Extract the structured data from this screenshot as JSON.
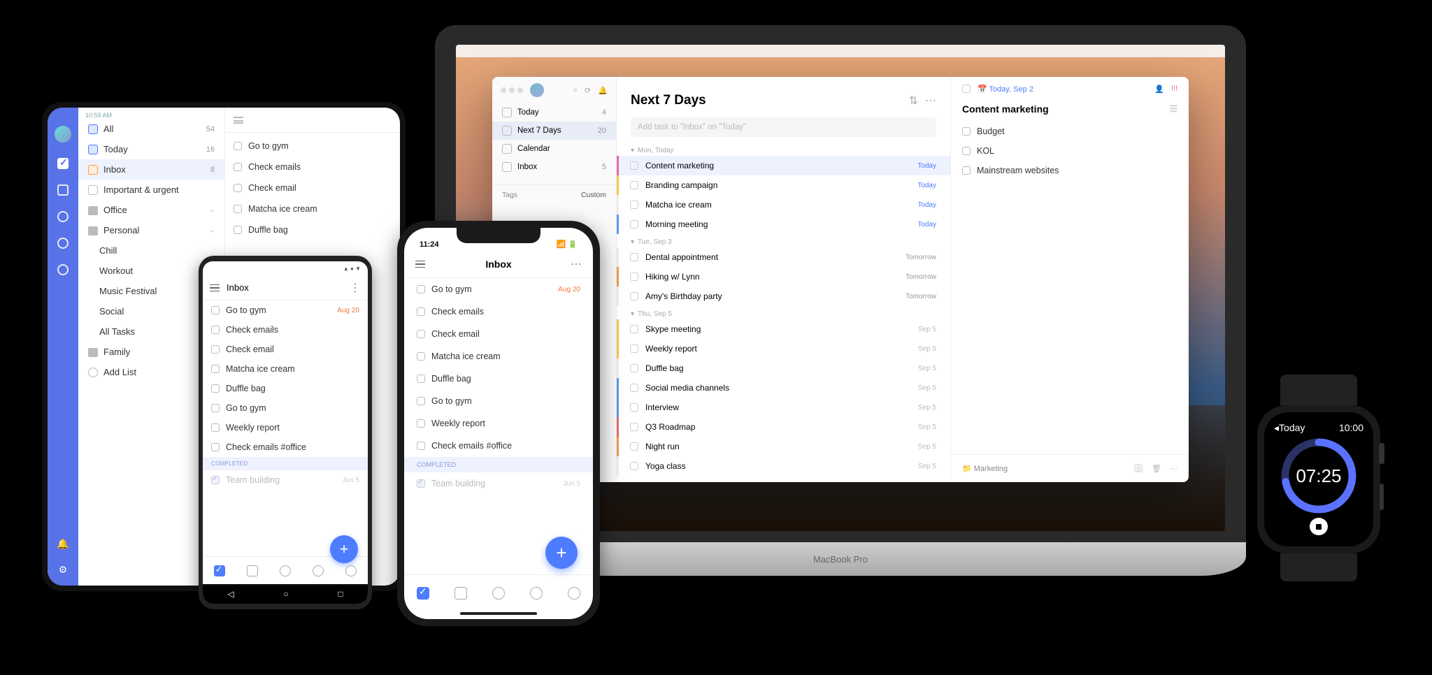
{
  "ipad": {
    "status_time": "10:59 AM",
    "smart": {
      "all": {
        "label": "All",
        "count": "54"
      },
      "today": {
        "label": "Today",
        "count": "16"
      },
      "inbox": {
        "label": "Inbox",
        "count": "8"
      },
      "important": {
        "label": "Important & urgent",
        "count": ""
      }
    },
    "lists": {
      "office": "Office",
      "personal": "Personal",
      "family": "Family",
      "add": "Add List",
      "sub": [
        "Chill",
        "Workout",
        "Music Festival",
        "Social",
        "All Tasks"
      ]
    },
    "tasks": [
      {
        "t": "Go to gym"
      },
      {
        "t": "Check emails"
      },
      {
        "t": "Check email"
      },
      {
        "t": "Matcha ice cream"
      },
      {
        "t": "Duffle bag"
      }
    ]
  },
  "android": {
    "title": "Inbox",
    "status_icons": "▲ ● ▼",
    "tasks": [
      {
        "t": "Go to gym",
        "due": "Aug 20"
      },
      {
        "t": "Check emails"
      },
      {
        "t": "Check email"
      },
      {
        "t": "Matcha ice cream"
      },
      {
        "t": "Duffle bag"
      },
      {
        "t": "Go to gym"
      },
      {
        "t": "Weekly report"
      },
      {
        "t": "Check emails #office"
      }
    ],
    "completed_label": "COMPLETED",
    "completed": [
      {
        "t": "Team building",
        "due": "Jun 5"
      }
    ]
  },
  "iphone": {
    "status_time": "11:24",
    "title": "Inbox",
    "tasks": [
      {
        "t": "Go to gym",
        "due": "Aug 20"
      },
      {
        "t": "Check emails"
      },
      {
        "t": "Check email"
      },
      {
        "t": "Matcha ice cream"
      },
      {
        "t": "Duffle bag"
      },
      {
        "t": "Go to gym"
      },
      {
        "t": "Weekly report"
      },
      {
        "t": "Check emails #office"
      }
    ],
    "completed_label": "COMPLETED",
    "completed": [
      {
        "t": "Team building",
        "due": "Jun 5"
      }
    ]
  },
  "mac": {
    "sidebar": {
      "today": {
        "label": "Today",
        "count": "4"
      },
      "next7": {
        "label": "Next 7 Days",
        "count": "20"
      },
      "calendar": {
        "label": "Calendar"
      },
      "inbox": {
        "label": "Inbox",
        "count": "5"
      },
      "tags_header": "Tags",
      "filter_custom": "Custom"
    },
    "title": "Next 7 Days",
    "add_placeholder": "Add task to \"Inbox\" on \"Today\"",
    "groups": {
      "g0": "Mon, Today",
      "g1": "Tue, Sep 3",
      "g2": "Thu, Sep 5"
    },
    "tasks": {
      "content_marketing": {
        "t": "Content marketing",
        "due": "Today"
      },
      "branding": {
        "t": "Branding campaign",
        "due": "Today"
      },
      "matcha": {
        "t": "Matcha ice cream",
        "due": "Today"
      },
      "morning": {
        "t": "Morning meeting",
        "due": "Today"
      },
      "dental": {
        "t": "Dental appointment",
        "due": "Tomorrow"
      },
      "hiking": {
        "t": "Hiking w/ Lynn",
        "due": "Tomorrow"
      },
      "amy": {
        "t": "Amy's Birthday party",
        "due": "Tomorrow"
      },
      "skype": {
        "t": "Skype meeting",
        "due": "Sep 5"
      },
      "weekly": {
        "t": "Weekly report",
        "due": "Sep 5"
      },
      "duffle": {
        "t": "Duffle bag",
        "due": "Sep 5"
      },
      "social": {
        "t": "Social media channels",
        "due": "Sep 5"
      },
      "interview": {
        "t": "Interview",
        "due": "Sep 5"
      },
      "q3": {
        "t": "Q3 Roadmap",
        "due": "Sep 5"
      },
      "run": {
        "t": "Night run",
        "due": "Sep 5"
      },
      "yoga": {
        "t": "Yoga class",
        "due": "Sep 5"
      }
    },
    "detail": {
      "date": "Today, Sep 2",
      "title": "Content marketing",
      "subtasks": [
        "Budget",
        "KOL",
        "Mainstream websites"
      ],
      "list": "Marketing"
    },
    "base_label": "MacBook Pro"
  },
  "watch": {
    "back": "◂Today",
    "clock": "10:00",
    "timer": "07:25"
  }
}
